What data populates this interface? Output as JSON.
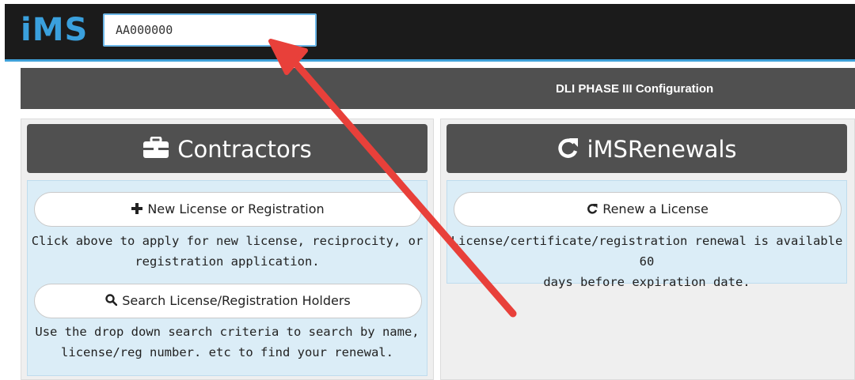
{
  "header": {
    "logo": "iMS",
    "search_value": "AA000000"
  },
  "phasebar": {
    "title": "DLI PHASE III Configuration"
  },
  "contractors": {
    "title": "Contractors",
    "title_icon": "briefcase-icon",
    "new_license": {
      "label": "New License or Registration",
      "icon": "plus-icon",
      "description_line1": "Click above to apply for new license, reciprocity, or",
      "description_line2": "registration application."
    },
    "search_holders": {
      "label": "Search License/Registration Holders",
      "icon": "search-icon",
      "description_line1": "Use the drop down search criteria to search by name,",
      "description_line2": "license/reg number. etc to find your renewal."
    }
  },
  "renewals": {
    "title": "iMSRenewals",
    "title_icon": "refresh-icon",
    "renew": {
      "label": "Renew a License",
      "icon": "refresh-icon",
      "description_line1": "License/certificate/registration renewal is available 60",
      "description_line2": "days before expiration date."
    }
  },
  "annotation": {
    "arrow_color": "#e8403a"
  },
  "colors": {
    "accent": "#3aa0dd",
    "dark_bar": "#505050",
    "panel_body": "#dbedf7"
  }
}
